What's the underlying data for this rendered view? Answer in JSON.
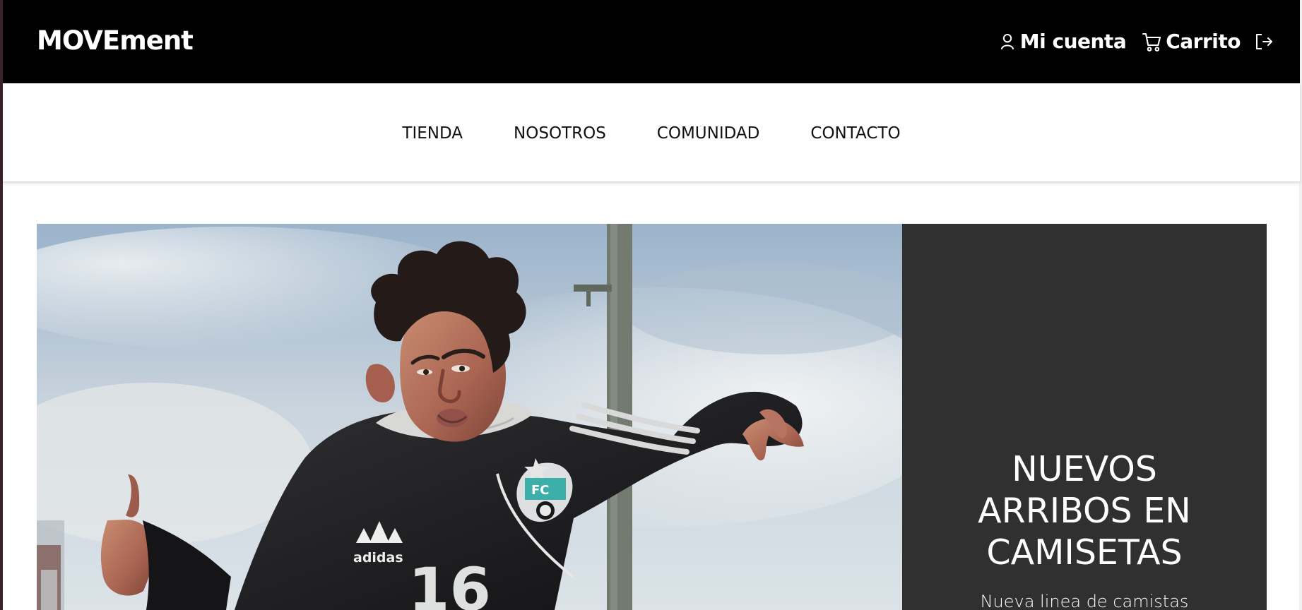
{
  "header": {
    "brand": "MOVEment",
    "account_label": "Mi cuenta",
    "cart_label": "Carrito",
    "account_icon": "user-icon",
    "cart_icon": "shopping-cart-icon",
    "logout_icon": "logout-icon"
  },
  "navigation": {
    "items": [
      {
        "label": "TIENDA"
      },
      {
        "label": "NOSOTROS"
      },
      {
        "label": "COMUNIDAD"
      },
      {
        "label": "CONTACTO"
      }
    ]
  },
  "hero": {
    "image_subject": "soccer player in black jersey",
    "jersey_number": "16",
    "title_lines": [
      "NUEVOS",
      "ARRIBOS EN",
      "CAMISETAS"
    ],
    "subtitle": "Nueva linea de camistas"
  },
  "colors": {
    "topbar": "#000000",
    "nav_background": "#ffffff",
    "promo_panel": "#303030",
    "text_light": "#ffffff",
    "text_dark": "#111111"
  }
}
